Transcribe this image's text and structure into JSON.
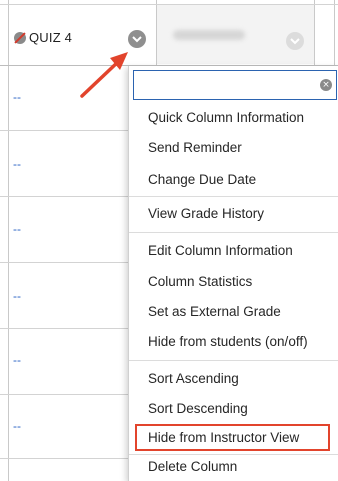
{
  "header": {
    "column_title": "QUIZ 4",
    "status_icon": "no-entry-icon",
    "menu_toggle_icon": "chevron-down-icon"
  },
  "rows": [
    {
      "value": "--"
    },
    {
      "value": "--"
    },
    {
      "value": "--"
    },
    {
      "value": "--"
    },
    {
      "value": "--"
    },
    {
      "value": "--"
    }
  ],
  "menu": {
    "search_value": "",
    "clear_icon": "clear-icon",
    "items": [
      {
        "label": "Quick Column Information"
      },
      {
        "label": "Send Reminder"
      },
      {
        "label": "Change Due Date"
      },
      {
        "label": "View Grade History"
      },
      {
        "label": "Edit Column Information"
      },
      {
        "label": "Column Statistics"
      },
      {
        "label": "Set as External Grade"
      },
      {
        "label": "Hide from students (on/off)"
      },
      {
        "label": "Sort Ascending"
      },
      {
        "label": "Sort Descending"
      },
      {
        "label": "Hide from Instructor View"
      },
      {
        "label": "Delete Column"
      }
    ]
  },
  "colors": {
    "accent": "#2b63b0",
    "annotation": "#e2442c",
    "link": "#2a63c4"
  }
}
